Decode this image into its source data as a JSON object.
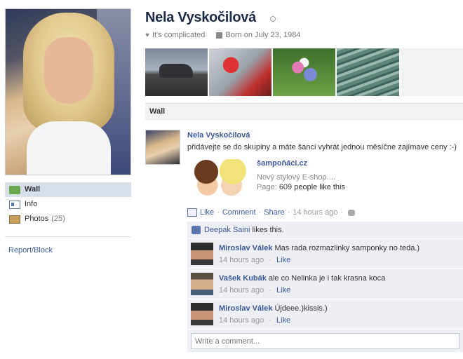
{
  "profile": {
    "name": "Nela Vyskočilová",
    "relationship": "It's complicated",
    "birthday": "Born on July 23, 1984"
  },
  "left_nav": {
    "items": [
      {
        "label": "Wall",
        "count": ""
      },
      {
        "label": "Info",
        "count": ""
      },
      {
        "label": "Photos",
        "count": "(25)"
      }
    ],
    "report": "Report/Block"
  },
  "wall": {
    "header": "Wall"
  },
  "story": {
    "author": "Nela Vyskočilová",
    "message": "přidávejte se do skupiny a máte šanci vyhrát jednou měsíčne zajímave ceny :-)",
    "attachment": {
      "title": "šampoňáci.cz",
      "caption": "Nový stylový E-shop....",
      "page_label": "Page:",
      "page_value": "609 people like this"
    },
    "actions": {
      "like": "Like",
      "comment": "Comment",
      "share": "Share",
      "time": "14 hours ago"
    },
    "likes": {
      "name": "Deepak Saini",
      "suffix": "likes this."
    },
    "comments": [
      {
        "author": "Miroslav Válek",
        "text": "Mas rada rozmazlinky samponky no teda.)",
        "time": "14 hours ago",
        "like": "Like"
      },
      {
        "author": "Vašek Kubák",
        "text": "ale co Nelinka je i tak krasna koca",
        "time": "14 hours ago",
        "like": "Like"
      },
      {
        "author": "Miroslav Válek",
        "text": "Újdeee.)kissis.)",
        "time": "14 hours ago",
        "like": "Like"
      }
    ],
    "write_comment_placeholder": "Write a comment..."
  },
  "colors": {
    "link": "#3b5998",
    "nav_active": "#d8dfea",
    "feedback_bg": "#edeff4",
    "name": "#1c2a47"
  }
}
